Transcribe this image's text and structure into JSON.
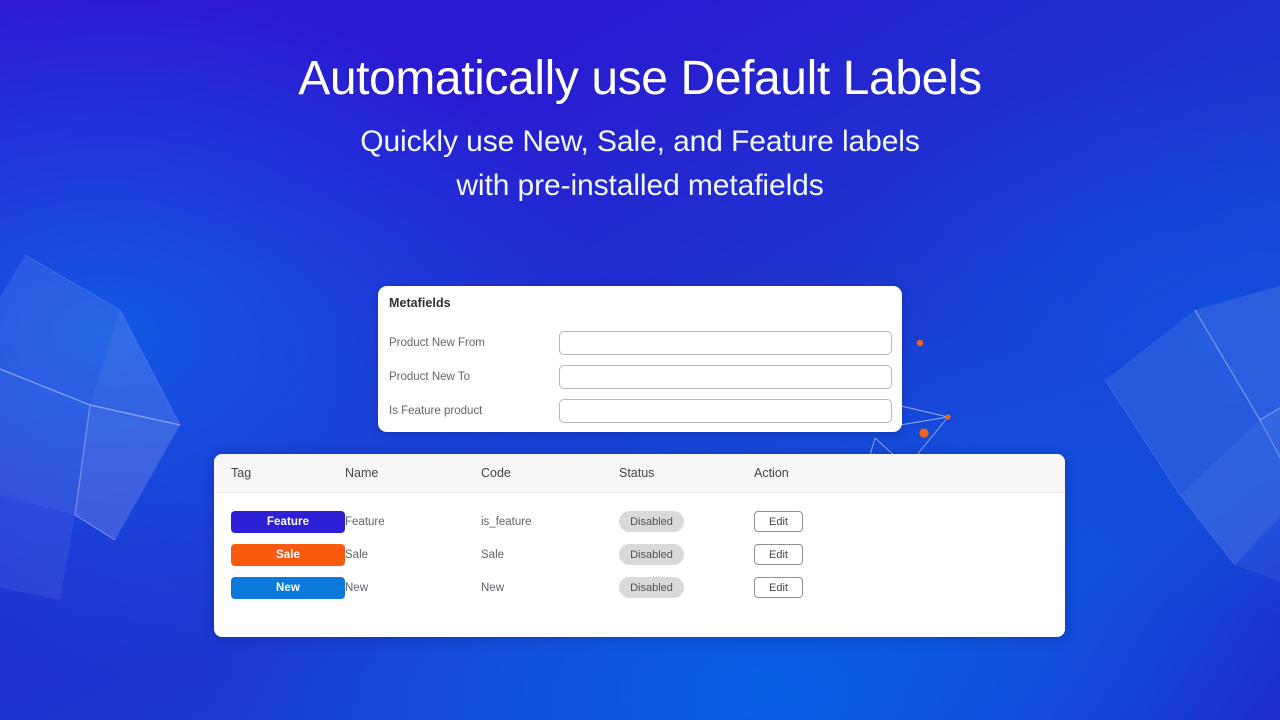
{
  "hero": {
    "headline": "Automatically use Default Labels",
    "subhead_line1": "Quickly use New, Sale, and Feature labels",
    "subhead_line2": "with pre-installed metafields"
  },
  "metafields_card": {
    "title": "Metafields",
    "fields": [
      {
        "label": "Product New From",
        "value": "",
        "placeholder": ""
      },
      {
        "label": "Product New To",
        "value": "",
        "placeholder": ""
      },
      {
        "label": "Is Feature product",
        "value": "",
        "placeholder": ""
      }
    ]
  },
  "labels_table": {
    "columns": [
      "Tag",
      "Name",
      "Code",
      "Status",
      "Action"
    ],
    "rows": [
      {
        "tag": "Feature",
        "tag_color": "#2D1FD6",
        "name": "Feature",
        "code": "is_feature",
        "status": "Disabled",
        "action": "Edit"
      },
      {
        "tag": "Sale",
        "tag_color": "#FA5A10",
        "name": "Sale",
        "code": "Sale",
        "status": "Disabled",
        "action": "Edit"
      },
      {
        "tag": "New",
        "tag_color": "#0C79DC",
        "name": "New",
        "code": "New",
        "status": "Disabled",
        "action": "Edit"
      }
    ]
  },
  "theme": {
    "background_start": "#2F18D4",
    "background_mid": "#1A3ED2",
    "background_end": "#0E51D6",
    "accent_orange": "#FA5A10",
    "badge_grey": "#D9D9D9",
    "card_white": "#FFFFFF"
  }
}
